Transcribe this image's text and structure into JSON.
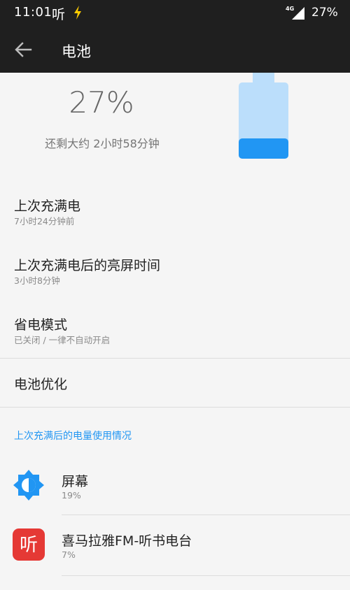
{
  "status_bar": {
    "time": "11:01",
    "app_glyph": "听",
    "network": "4G",
    "battery": "27%"
  },
  "app_bar": {
    "title": "电池",
    "back_icon": "arrow-back-icon"
  },
  "battery_header": {
    "percent": "27%",
    "remaining": "还剩大约 2小时58分钟",
    "level": 0.27,
    "fill_color": "#2196f3",
    "empty_color": "#bbdefb"
  },
  "settings": [
    {
      "title": "上次充满电",
      "subtitle": "7小时24分钟前"
    },
    {
      "title": "上次充满电后的亮屏时间",
      "subtitle": "3小时8分钟"
    },
    {
      "title": "省电模式",
      "subtitle": "已关闭 / 一律不自动开启"
    },
    {
      "title": "电池优化"
    }
  ],
  "usage": {
    "header": "上次充满后的电量使用情况",
    "accent": "#2196f3",
    "items": [
      {
        "title": "屏幕",
        "value": "19%",
        "icon": "brightness-icon"
      },
      {
        "title": "喜马拉雅FM-听书电台",
        "value": "7%",
        "icon": "ximalaya-app-icon",
        "icon_glyph": "听",
        "icon_color": "#e53935"
      }
    ]
  }
}
